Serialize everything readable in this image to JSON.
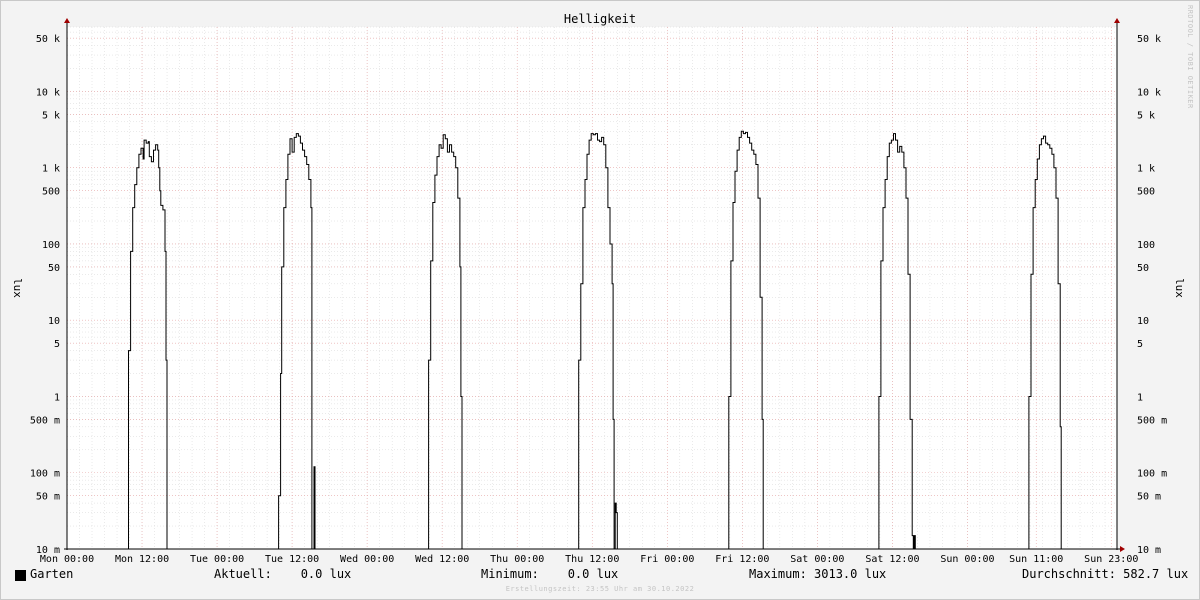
{
  "chart_data": {
    "type": "line",
    "title": "Helligkeit",
    "ylabel": "lux",
    "y_scale": "log",
    "ylim": [
      0.01,
      70000
    ],
    "y_ticks": [
      {
        "v": 0.01,
        "label": "10 m"
      },
      {
        "v": 0.05,
        "label": "50 m"
      },
      {
        "v": 0.1,
        "label": "100 m"
      },
      {
        "v": 0.5,
        "label": "500 m"
      },
      {
        "v": 1,
        "label": "1"
      },
      {
        "v": 5,
        "label": "5"
      },
      {
        "v": 10,
        "label": "10"
      },
      {
        "v": 50,
        "label": "50"
      },
      {
        "v": 100,
        "label": "100"
      },
      {
        "v": 500,
        "label": "500"
      },
      {
        "v": 1000,
        "label": "1 k"
      },
      {
        "v": 5000,
        "label": "5 k"
      },
      {
        "v": 10000,
        "label": "10 k"
      },
      {
        "v": 50000,
        "label": "50 k"
      }
    ],
    "xlim": [
      "Mon 00:00",
      "Sun 23:55"
    ],
    "x_ticks": [
      {
        "t": "Mon 00:00",
        "label": "Mon 00:00"
      },
      {
        "t": "Mon 12:00",
        "label": "Mon 12:00"
      },
      {
        "t": "Tue 00:00",
        "label": "Tue 00:00"
      },
      {
        "t": "Tue 12:00",
        "label": "Tue 12:00"
      },
      {
        "t": "Wed 00:00",
        "label": "Wed 00:00"
      },
      {
        "t": "Wed 12:00",
        "label": "Wed 12:00"
      },
      {
        "t": "Thu 00:00",
        "label": "Thu 00:00"
      },
      {
        "t": "Thu 12:00",
        "label": "Thu 12:00"
      },
      {
        "t": "Fri 00:00",
        "label": "Fri 00:00"
      },
      {
        "t": "Fri 12:00",
        "label": "Fri 12:00"
      },
      {
        "t": "Sat 00:00",
        "label": "Sat 00:00"
      },
      {
        "t": "Sat 12:00",
        "label": "Sat 12:00"
      },
      {
        "t": "Sun 00:00",
        "label": "Sun 00:00"
      },
      {
        "t": "Sun 11:00",
        "label": "Sun 11:00"
      },
      {
        "t": "Sun 23:00",
        "label": "Sun 23:00"
      }
    ],
    "grid": true,
    "series": [
      {
        "name": "Garten",
        "color": "#000000",
        "points": [
          [
            "Mon 00:00",
            0.01
          ],
          [
            "Mon 09:40",
            0.01
          ],
          [
            "Mon 09:50",
            4
          ],
          [
            "Mon 10:10",
            80
          ],
          [
            "Mon 10:30",
            300
          ],
          [
            "Mon 10:50",
            600
          ],
          [
            "Mon 11:10",
            1000
          ],
          [
            "Mon 11:30",
            1500
          ],
          [
            "Mon 11:50",
            1800
          ],
          [
            "Mon 12:10",
            1300
          ],
          [
            "Mon 12:20",
            2300
          ],
          [
            "Mon 12:40",
            2100
          ],
          [
            "Mon 13:00",
            2200
          ],
          [
            "Mon 13:10",
            1400
          ],
          [
            "Mon 13:30",
            1200
          ],
          [
            "Mon 13:50",
            1700
          ],
          [
            "Mon 14:10",
            2000
          ],
          [
            "Mon 14:30",
            1700
          ],
          [
            "Mon 14:40",
            1000
          ],
          [
            "Mon 14:50",
            500
          ],
          [
            "Mon 15:00",
            320
          ],
          [
            "Mon 15:20",
            280
          ],
          [
            "Mon 15:40",
            80
          ],
          [
            "Mon 15:50",
            3
          ],
          [
            "Mon 16:00",
            0.01
          ],
          [
            "Tue 09:40",
            0.01
          ],
          [
            "Tue 09:50",
            0.05
          ],
          [
            "Tue 10:10",
            2
          ],
          [
            "Tue 10:20",
            50
          ],
          [
            "Tue 10:40",
            300
          ],
          [
            "Tue 11:00",
            700
          ],
          [
            "Tue 11:20",
            1500
          ],
          [
            "Tue 11:40",
            2400
          ],
          [
            "Tue 12:00",
            1600
          ],
          [
            "Tue 12:20",
            2500
          ],
          [
            "Tue 12:40",
            2800
          ],
          [
            "Tue 13:00",
            2600
          ],
          [
            "Tue 13:20",
            2100
          ],
          [
            "Tue 13:40",
            1700
          ],
          [
            "Tue 14:00",
            1400
          ],
          [
            "Tue 14:20",
            1100
          ],
          [
            "Tue 14:40",
            700
          ],
          [
            "Tue 15:00",
            300
          ],
          [
            "Tue 15:10",
            0.01
          ],
          [
            "Tue 15:20",
            0.01
          ],
          [
            "Tue 15:30",
            0.12
          ],
          [
            "Tue 15:40",
            0.01
          ],
          [
            "Wed 09:40",
            0.01
          ],
          [
            "Wed 09:50",
            3
          ],
          [
            "Wed 10:10",
            60
          ],
          [
            "Wed 10:30",
            350
          ],
          [
            "Wed 10:50",
            800
          ],
          [
            "Wed 11:10",
            1400
          ],
          [
            "Wed 11:30",
            2000
          ],
          [
            "Wed 11:50",
            1800
          ],
          [
            "Wed 12:10",
            2700
          ],
          [
            "Wed 12:30",
            2400
          ],
          [
            "Wed 12:50",
            1600
          ],
          [
            "Wed 13:10",
            2000
          ],
          [
            "Wed 13:30",
            1600
          ],
          [
            "Wed 13:50",
            1400
          ],
          [
            "Wed 14:10",
            1000
          ],
          [
            "Wed 14:30",
            400
          ],
          [
            "Wed 14:50",
            50
          ],
          [
            "Wed 15:00",
            1
          ],
          [
            "Wed 15:10",
            0.01
          ],
          [
            "Thu 09:40",
            0.01
          ],
          [
            "Thu 09:50",
            3
          ],
          [
            "Thu 10:10",
            30
          ],
          [
            "Thu 10:30",
            300
          ],
          [
            "Thu 10:50",
            700
          ],
          [
            "Thu 11:10",
            1500
          ],
          [
            "Thu 11:30",
            2300
          ],
          [
            "Thu 11:50",
            2800
          ],
          [
            "Thu 12:10",
            2700
          ],
          [
            "Thu 12:30",
            2800
          ],
          [
            "Thu 12:50",
            2300
          ],
          [
            "Thu 13:10",
            2200
          ],
          [
            "Thu 13:30",
            2500
          ],
          [
            "Thu 13:50",
            2000
          ],
          [
            "Thu 14:10",
            1000
          ],
          [
            "Thu 14:30",
            300
          ],
          [
            "Thu 14:50",
            100
          ],
          [
            "Thu 15:10",
            30
          ],
          [
            "Thu 15:20",
            0.5
          ],
          [
            "Thu 15:30",
            0.01
          ],
          [
            "Thu 15:40",
            0.04
          ],
          [
            "Thu 15:50",
            0.03
          ],
          [
            "Thu 16:00",
            0.01
          ],
          [
            "Fri 09:40",
            0.01
          ],
          [
            "Fri 09:50",
            1
          ],
          [
            "Fri 10:10",
            60
          ],
          [
            "Fri 10:30",
            350
          ],
          [
            "Fri 10:50",
            900
          ],
          [
            "Fri 11:10",
            1700
          ],
          [
            "Fri 11:30",
            2500
          ],
          [
            "Fri 11:50",
            3013
          ],
          [
            "Fri 12:10",
            2800
          ],
          [
            "Fri 12:30",
            2900
          ],
          [
            "Fri 12:50",
            2500
          ],
          [
            "Fri 13:10",
            2100
          ],
          [
            "Fri 13:30",
            1700
          ],
          [
            "Fri 13:50",
            1500
          ],
          [
            "Fri 14:10",
            1100
          ],
          [
            "Fri 14:30",
            400
          ],
          [
            "Fri 14:50",
            20
          ],
          [
            "Fri 15:10",
            0.5
          ],
          [
            "Fri 15:20",
            0.01
          ],
          [
            "Sat 09:40",
            0.01
          ],
          [
            "Sat 09:50",
            1
          ],
          [
            "Sat 10:10",
            60
          ],
          [
            "Sat 10:30",
            300
          ],
          [
            "Sat 10:50",
            700
          ],
          [
            "Sat 11:10",
            1400
          ],
          [
            "Sat 11:30",
            2100
          ],
          [
            "Sat 11:50",
            2300
          ],
          [
            "Sat 12:10",
            2800
          ],
          [
            "Sat 12:30",
            2300
          ],
          [
            "Sat 12:50",
            1600
          ],
          [
            "Sat 13:10",
            1900
          ],
          [
            "Sat 13:30",
            1600
          ],
          [
            "Sat 13:50",
            1000
          ],
          [
            "Sat 14:10",
            400
          ],
          [
            "Sat 14:30",
            40
          ],
          [
            "Sat 14:50",
            0.5
          ],
          [
            "Sat 15:10",
            0.015
          ],
          [
            "Sat 15:20",
            0.01
          ],
          [
            "Sat 15:30",
            0.015
          ],
          [
            "Sat 15:40",
            0.01
          ],
          [
            "Sun 09:40",
            0.01
          ],
          [
            "Sun 09:50",
            1
          ],
          [
            "Sun 10:10",
            40
          ],
          [
            "Sun 10:30",
            300
          ],
          [
            "Sun 10:50",
            700
          ],
          [
            "Sun 11:10",
            1300
          ],
          [
            "Sun 11:30",
            2000
          ],
          [
            "Sun 11:50",
            2400
          ],
          [
            "Sun 12:10",
            2600
          ],
          [
            "Sun 12:30",
            2100
          ],
          [
            "Sun 12:50",
            2000
          ],
          [
            "Sun 13:10",
            1800
          ],
          [
            "Sun 13:30",
            1500
          ],
          [
            "Sun 13:50",
            1000
          ],
          [
            "Sun 14:10",
            400
          ],
          [
            "Sun 14:30",
            30
          ],
          [
            "Sun 14:50",
            0.4
          ],
          [
            "Sun 15:00",
            0.01
          ],
          [
            "Sun 23:55",
            0.01
          ]
        ]
      }
    ]
  },
  "legend": {
    "series_name": "Garten",
    "aktuell": "Aktuell:    0.0 lux",
    "minimum": "Minimum:    0.0 lux",
    "maximum": "Maximum: 3013.0 lux",
    "durchschnitt": "Durchschnitt: 582.7 lux"
  },
  "footer": "Erstellungszeit: 23:55 Uhr am 30.10.2022",
  "watermark": "RRDTOOL / TOBI OETIKER"
}
